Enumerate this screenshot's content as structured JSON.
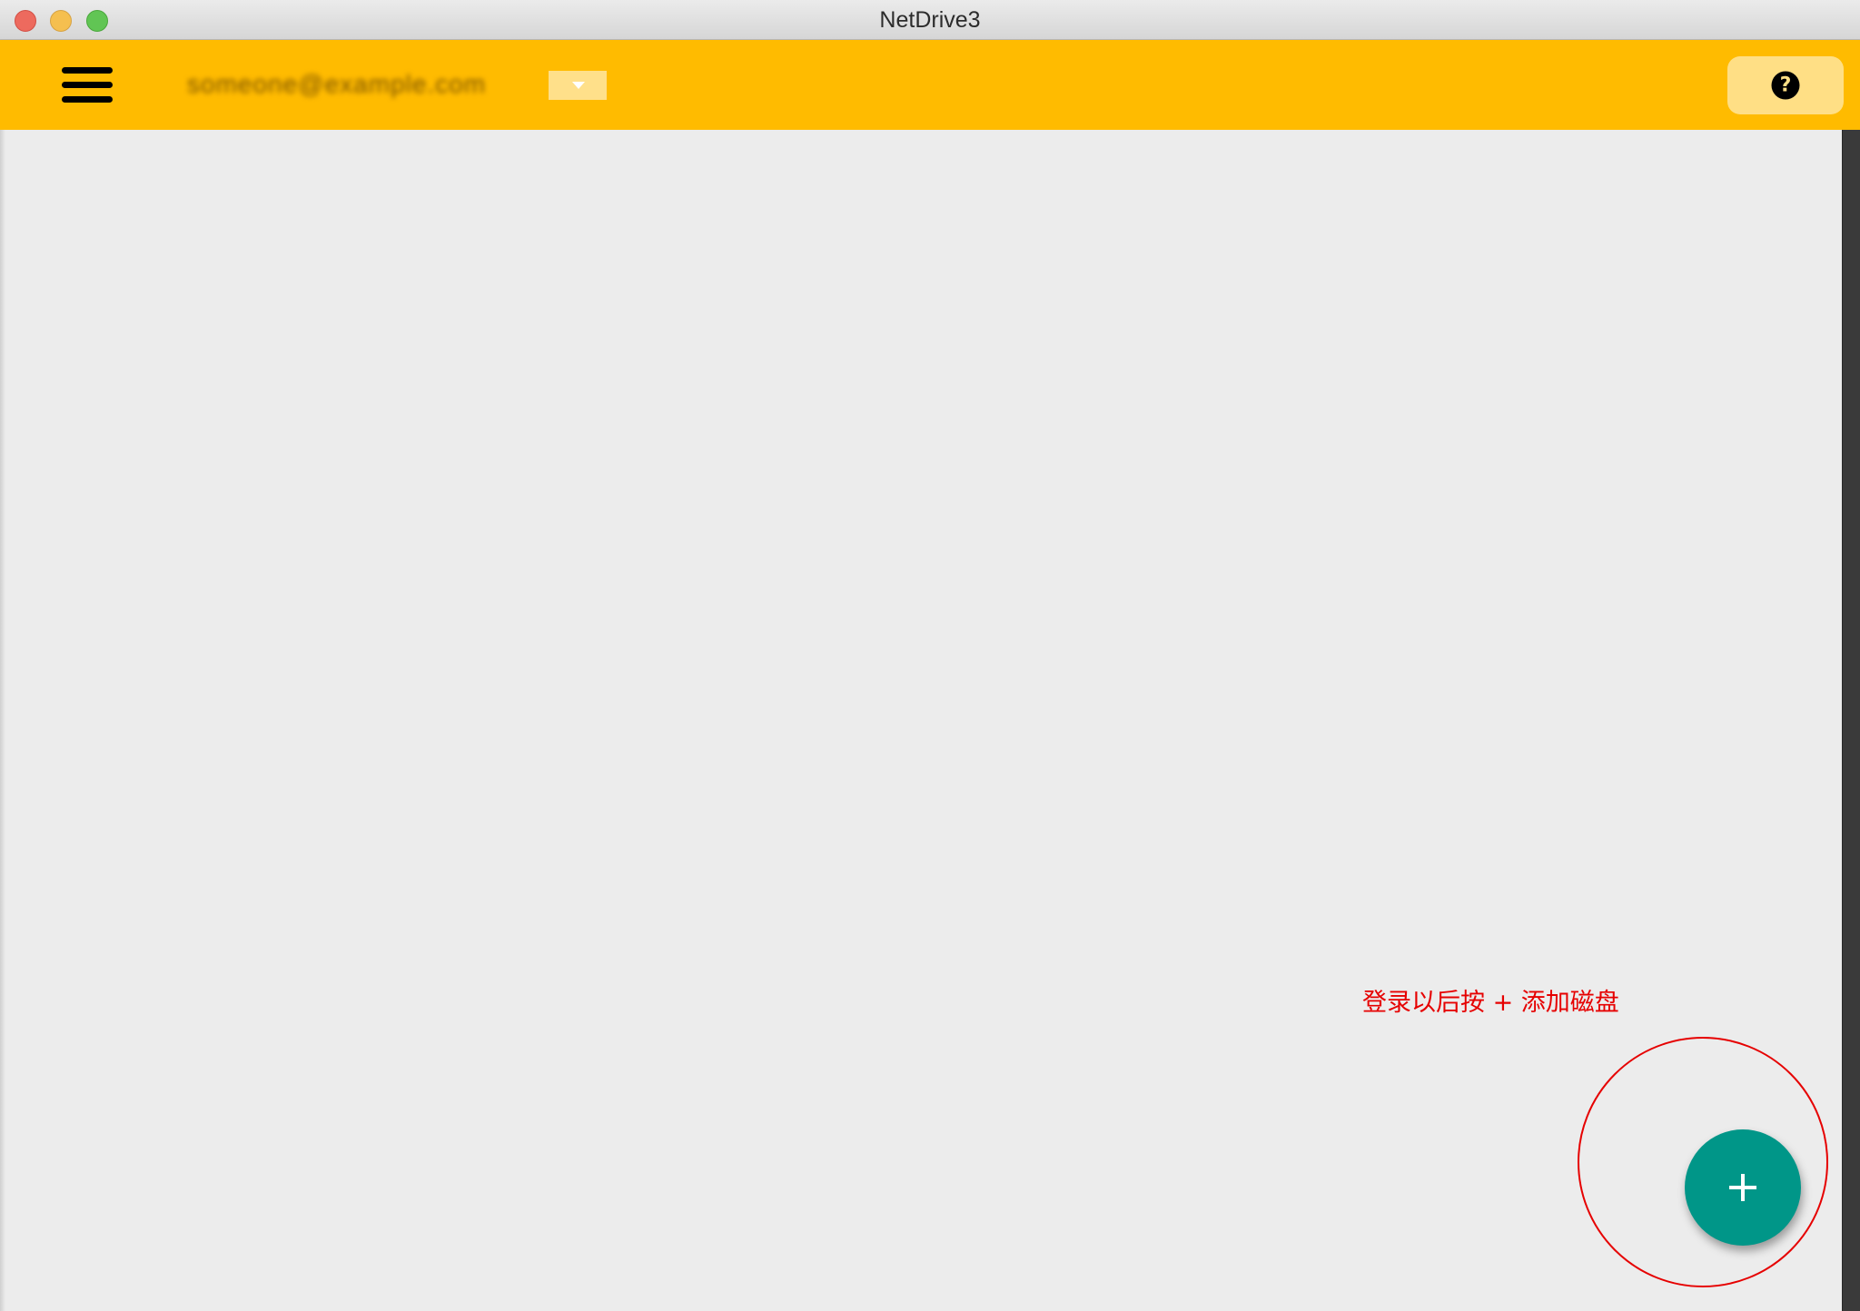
{
  "window": {
    "title": "NetDrive3"
  },
  "appbar": {
    "menu_icon": "hamburger-menu-icon",
    "account_email": "someone@example.com",
    "dropdown_icon": "caret-down-icon",
    "help_icon": "question-circle-icon",
    "help_glyph": "?",
    "background_color": "#ffbb00"
  },
  "content": {
    "hint_text": "登录以后按 + 添加磁盘",
    "hint_color": "#e60000"
  },
  "fab": {
    "icon": "plus-icon",
    "color": "#009688"
  }
}
